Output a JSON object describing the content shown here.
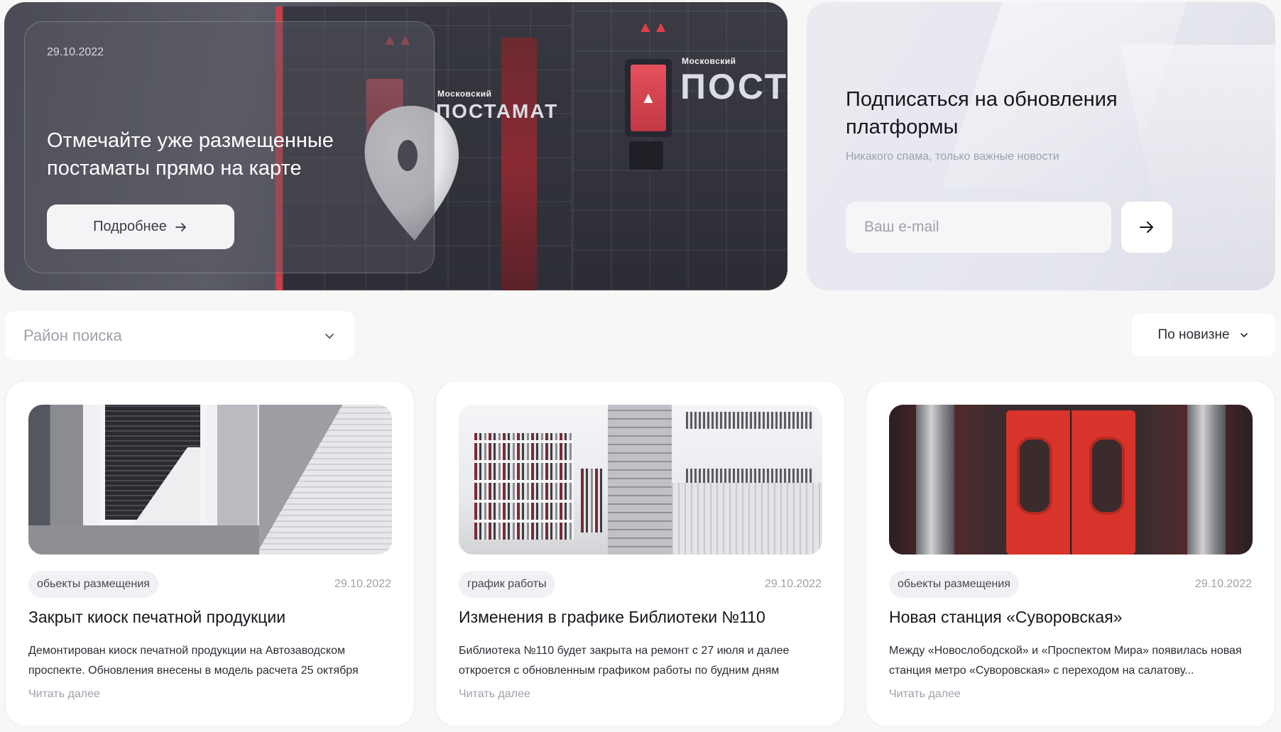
{
  "hero": {
    "date": "29.10.2022",
    "title": "Отмечайте уже размещенные постаматы прямо на карте",
    "button_label": "Подробнее",
    "brand_small": "Московский",
    "brand_large_a": "ПОСТАМАТ",
    "brand_large_b": "ПОСТАМ"
  },
  "subscribe": {
    "title": "Подписаться на обновления платформы",
    "note": "Никакого спама, только важные новости",
    "email_placeholder": "Ваш e-mail",
    "send_icon": "arrow-right-icon"
  },
  "filters": {
    "district_placeholder": "Район поиска",
    "sort_label": "По новизне"
  },
  "cards": [
    {
      "tag": "обьекты размещения",
      "date": "29.10.2022",
      "title": "Закрыт киоск печатной продукции",
      "description": "Демонтирован киоск печатной продукции на Автозаводском проспекте. Обновления внесены в модель расчета 25 октября",
      "more": "Читать далее"
    },
    {
      "tag": "график работы",
      "date": "29.10.2022",
      "title": "Изменения в графике Библиотеки №110",
      "description": "Библиотека №110 будет закрыта на ремонт с 27 июля и далее откроется с обновленным графиком работы по будним дням",
      "more": "Читать далее"
    },
    {
      "tag": "обьекты размещения",
      "date": "29.10.2022",
      "title": "Новая станция «Суворовская»",
      "description": "Между «Новослободской» и «Проспектом Мира» появилась новая станция метро «Суворовская» с переходом на салатову...",
      "more": "Читать далее"
    }
  ],
  "colors": {
    "page_bg": "#f7f7f8",
    "accent_red": "#e0404c",
    "muted_text": "#9ea1ab"
  }
}
